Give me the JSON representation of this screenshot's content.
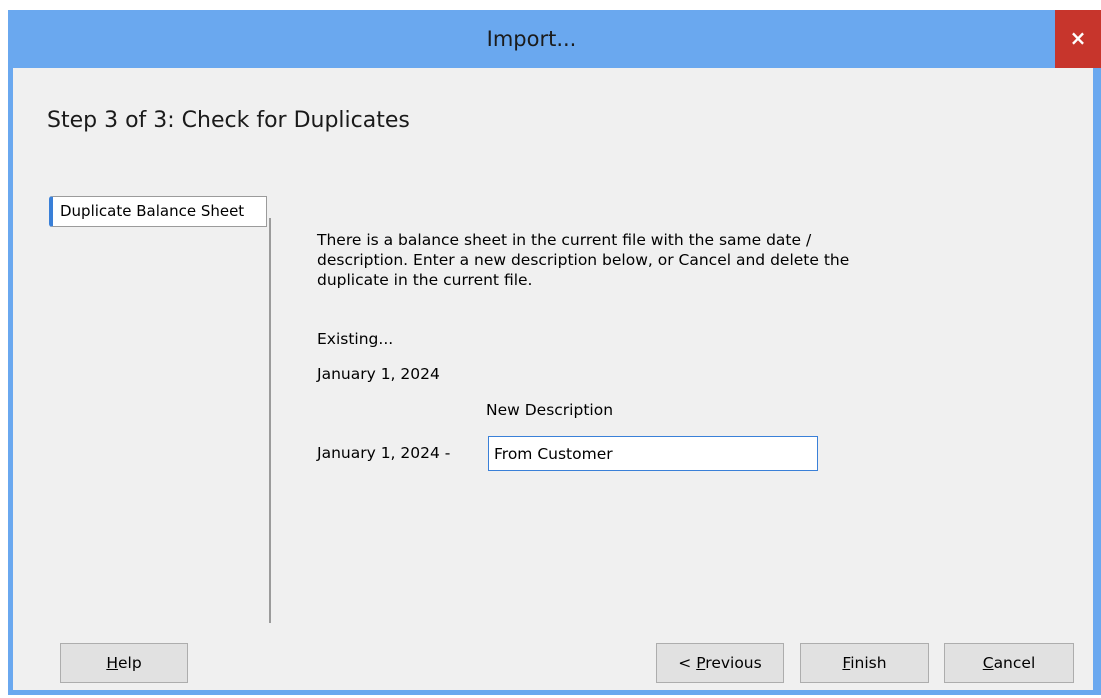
{
  "window": {
    "title": "Import...",
    "close_glyph": "×"
  },
  "step_title": "Step 3 of 3: Check for Duplicates",
  "tabs": [
    {
      "label": "Duplicate Balance Sheet",
      "selected": true
    }
  ],
  "message": "There is a balance sheet in the current file with the same date / description. Enter a new description below, or Cancel and delete the duplicate in the current file.",
  "existing_label": "Existing...",
  "existing_date": "January 1, 2024",
  "new_description_label": "New Description",
  "new_date_prefix": "January 1, 2024 -",
  "new_description_value": "From Customer",
  "buttons": {
    "help": {
      "mnemonic": "H",
      "rest": "elp"
    },
    "previous": {
      "prefix": "< ",
      "mnemonic": "P",
      "rest": "revious"
    },
    "finish": {
      "mnemonic": "F",
      "rest": "inish"
    },
    "cancel": {
      "mnemonic": "C",
      "rest": "ancel"
    }
  },
  "colors": {
    "titlebar": "#6aa8ef",
    "close_button": "#c7352c",
    "tab_accent": "#3a80d8"
  },
  "icons": {
    "close": "close-icon"
  }
}
